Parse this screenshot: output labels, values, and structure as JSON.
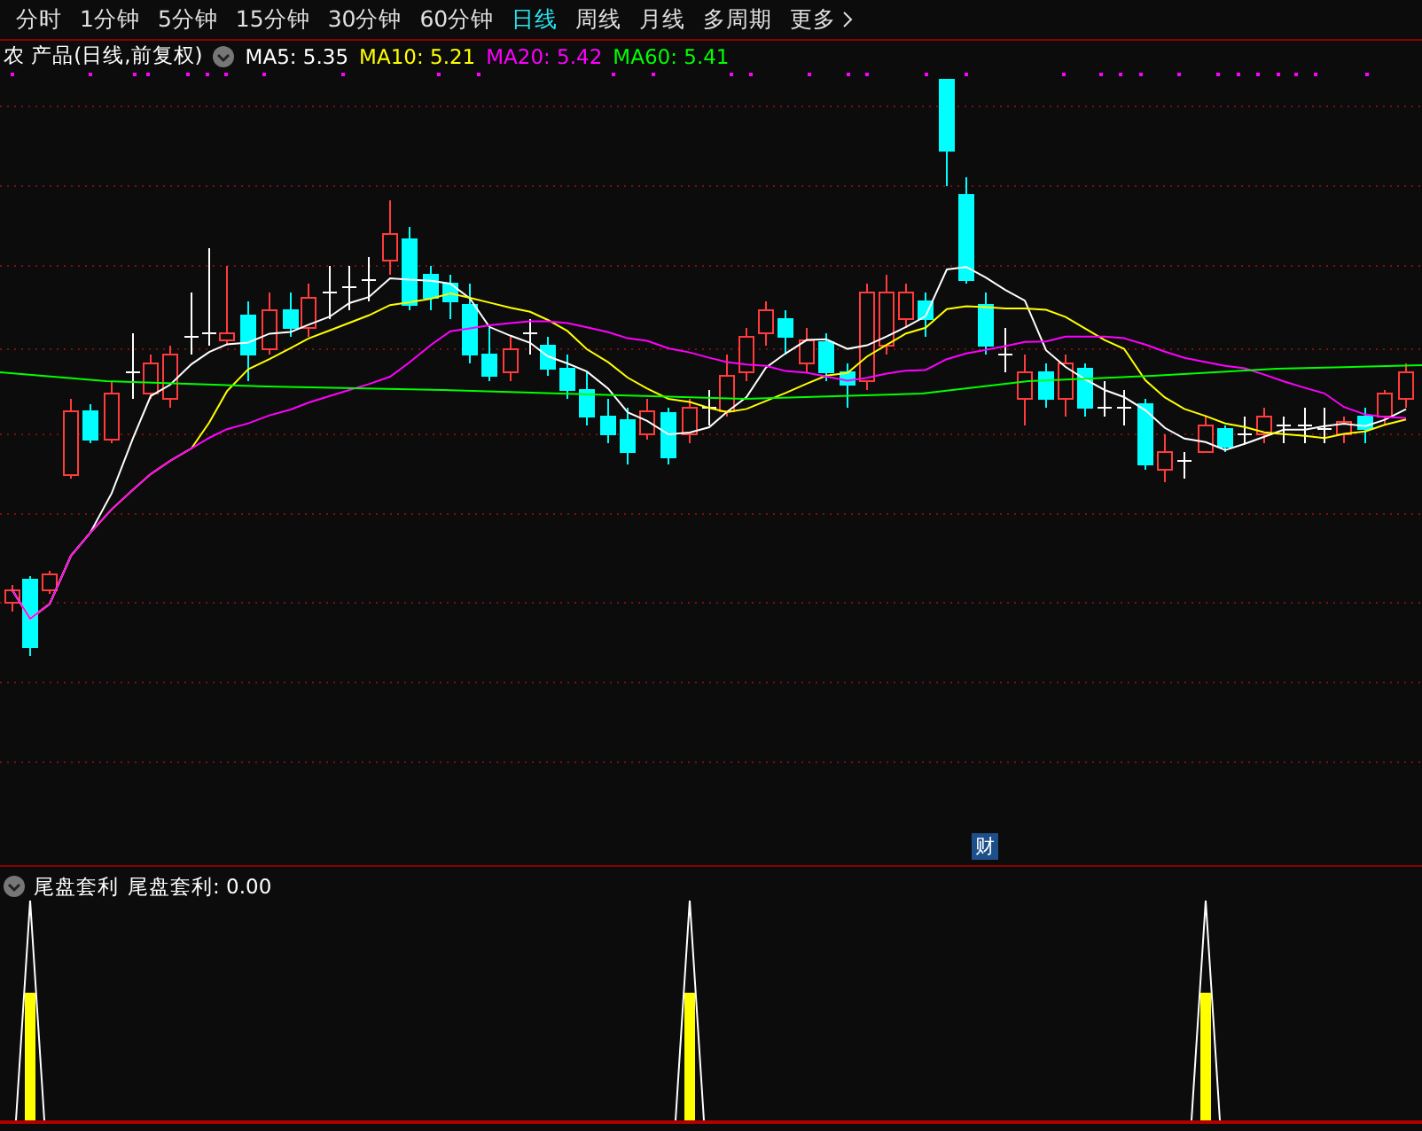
{
  "tabs": [
    {
      "label": "分时",
      "selected": false
    },
    {
      "label": "1分钟",
      "selected": false
    },
    {
      "label": "5分钟",
      "selected": false
    },
    {
      "label": "15分钟",
      "selected": false
    },
    {
      "label": "30分钟",
      "selected": false
    },
    {
      "label": "60分钟",
      "selected": false
    },
    {
      "label": "日线",
      "selected": true
    },
    {
      "label": "周线",
      "selected": false
    },
    {
      "label": "月线",
      "selected": false
    },
    {
      "label": "多周期",
      "selected": false
    },
    {
      "label": "更多",
      "selected": false
    }
  ],
  "legend": {
    "title": "农 产品(日线,前复权)",
    "averages": [
      {
        "label": "MA5: 5.35",
        "color": "#ffffff"
      },
      {
        "label": "MA10: 5.21",
        "color": "#ffff00"
      },
      {
        "label": "MA20: 5.42",
        "color": "#ff00ff"
      },
      {
        "label": "MA60: 5.41",
        "color": "#00ff00"
      }
    ]
  },
  "event_marker": "财",
  "indicator": {
    "name": "尾盘套利",
    "reading": "尾盘套利: 0.00"
  }
}
